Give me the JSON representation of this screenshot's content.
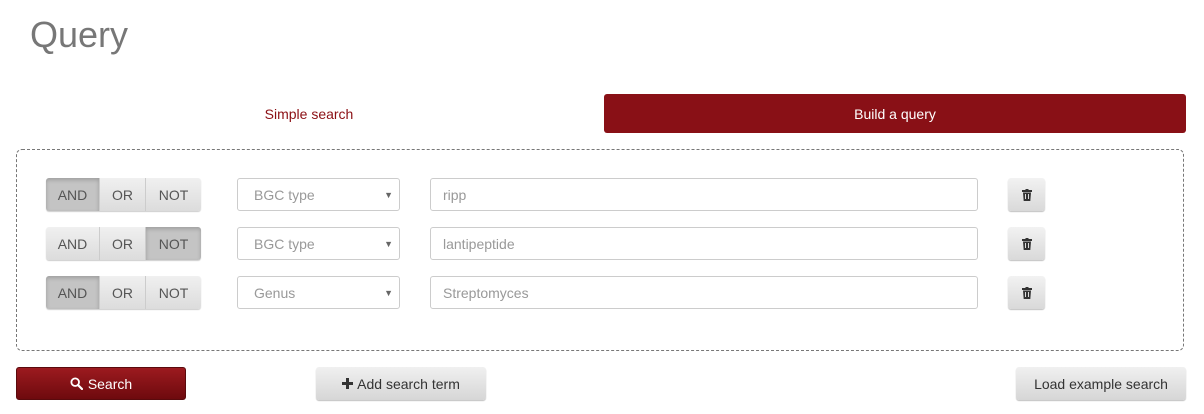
{
  "page": {
    "title": "Query"
  },
  "tabs": {
    "simple": "Simple search",
    "build": "Build a query"
  },
  "operators": {
    "and": "AND",
    "or": "OR",
    "not": "NOT"
  },
  "terms": [
    {
      "active_operator": "AND",
      "category": "BGC type",
      "value": "ripp"
    },
    {
      "active_operator": "NOT",
      "category": "BGC type",
      "value": "lantipeptide"
    },
    {
      "active_operator": "AND",
      "category": "Genus",
      "value": "Streptomyces"
    }
  ],
  "actions": {
    "search": "Search",
    "add_term": "Add search term",
    "load_example": "Load example search"
  },
  "icons": {
    "search": "search-icon",
    "plus": "plus-icon",
    "trash": "trash-icon",
    "caret": "caret-down-icon"
  },
  "colors": {
    "accent": "#891016",
    "accent_text": "#8b0f14"
  }
}
